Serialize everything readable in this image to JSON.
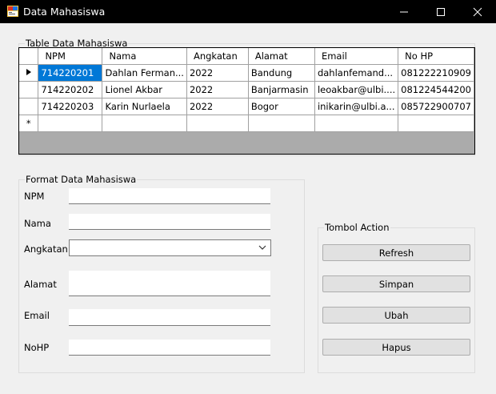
{
  "window": {
    "title": "Data Mahasiswa"
  },
  "table_group": {
    "legend": "Table Data Mahasiswa",
    "columns": [
      "NPM",
      "Nama",
      "Angkatan",
      "Alamat",
      "Email",
      "No HP"
    ],
    "rows": [
      [
        "714220201",
        "Dahlan Ferman...",
        "2022",
        "Bandung",
        "dahlanfemand...",
        "081222210909"
      ],
      [
        "714220202",
        "Lionel Akbar",
        "2022",
        "Banjarmasin",
        "leoakbar@ulbi....",
        "081224544200"
      ],
      [
        "714220203",
        "Karin Nurlaela",
        "2022",
        "Bogor",
        "inikarin@ulbi.a...",
        "085722900707"
      ]
    ],
    "new_row_marker": "*"
  },
  "form_group": {
    "legend": "Format Data Mahasiswa",
    "npm_label": "NPM",
    "nama_label": "Nama",
    "angkatan_label": "Angkatan",
    "alamat_label": "Alamat",
    "email_label": "Email",
    "nohp_label": "NoHP",
    "npm_value": "",
    "nama_value": "",
    "angkatan_value": "",
    "alamat_value": "",
    "email_value": "",
    "nohp_value": ""
  },
  "action_group": {
    "legend": "Tombol Action",
    "refresh_label": "Refresh",
    "simpan_label": "Simpan",
    "ubah_label": "Ubah",
    "hapus_label": "Hapus"
  },
  "colors": {
    "selection": "#0078d7",
    "titlebar": "#000000",
    "grid_background": "#ababab"
  }
}
